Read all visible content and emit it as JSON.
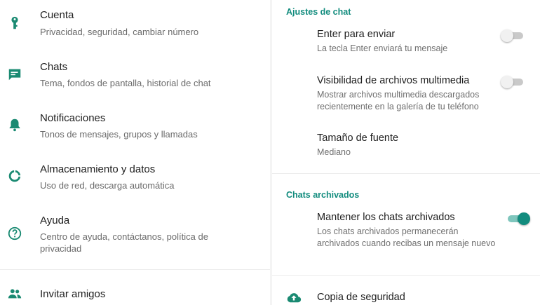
{
  "colors": {
    "accent": "#128c7e",
    "icon": "#1a8a72",
    "toggle_on": "#128c7e",
    "toggle_off": "#c9c9c9"
  },
  "left": {
    "items": [
      {
        "icon": "key-icon",
        "title": "Cuenta",
        "subtitle": "Privacidad, seguridad, cambiar número"
      },
      {
        "icon": "chat-icon",
        "title": "Chats",
        "subtitle": "Tema, fondos de pantalla, historial de chat"
      },
      {
        "icon": "bell-icon",
        "title": "Notificaciones",
        "subtitle": "Tonos de mensajes, grupos y llamadas"
      },
      {
        "icon": "data-usage-icon",
        "title": "Almacenamiento y datos",
        "subtitle": "Uso de red, descarga automática"
      },
      {
        "icon": "help-icon",
        "title": "Ayuda",
        "subtitle": "Centro de ayuda, contáctanos, política de privacidad"
      },
      {
        "icon": "people-icon",
        "title": "Invitar amigos",
        "subtitle": ""
      }
    ]
  },
  "right": {
    "section_chat_settings": "Ajustes de chat",
    "enter_to_send": {
      "title": "Enter para enviar",
      "subtitle": "La tecla Enter enviará tu mensaje",
      "enabled": false
    },
    "media_visibility": {
      "title": "Visibilidad de archivos multimedia",
      "subtitle": "Mostrar archivos multimedia descargados recientemente en la galería de tu teléfono",
      "enabled": false
    },
    "font_size": {
      "title": "Tamaño de fuente",
      "value": "Mediano"
    },
    "section_archived": "Chats archivados",
    "keep_archived": {
      "title": "Mantener los chats archivados",
      "subtitle": "Los chats archivados permanecerán archivados cuando recibas un mensaje nuevo",
      "enabled": true
    },
    "backup": {
      "icon": "cloud-upload-icon",
      "label": "Copia de seguridad"
    }
  }
}
